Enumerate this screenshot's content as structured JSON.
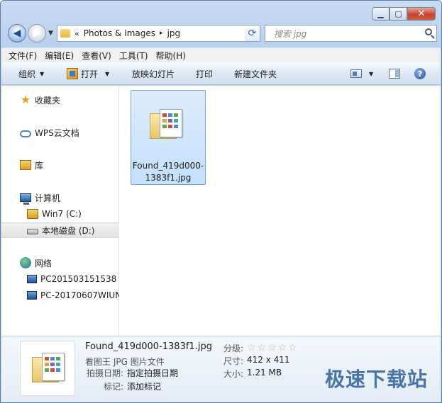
{
  "address": {
    "chevrons": "«",
    "segments": [
      "Photos & Images",
      "jpg"
    ],
    "separator": "▸"
  },
  "search": {
    "placeholder": "搜索 jpg"
  },
  "menu": [
    "文件(F)",
    "编辑(E)",
    "查看(V)",
    "工具(T)",
    "帮助(H)"
  ],
  "toolbar": {
    "organize": "组织",
    "open": "打开",
    "slideshow": "放映幻灯片",
    "print": "打印",
    "new_folder": "新建文件夹"
  },
  "nav": {
    "favorites": "收藏夹",
    "wps_cloud": "WPS云文档",
    "library": "库",
    "computer": "计算机",
    "drive_c": "Win7 (C:)",
    "drive_d": "本地磁盘 (D:)",
    "network": "网络",
    "pc1": "PC201503151538",
    "pc2": "PC-20170607WIUN"
  },
  "file": {
    "name": "Found_419d000-1383f1.jpg"
  },
  "details": {
    "title": "Found_419d000-1383f1.jpg",
    "type": "看图王 JPG 图片文件",
    "rating_label": "分级:",
    "rating_stars": 0,
    "rating_max": 5,
    "size_label": "尺寸:",
    "size_value": "412 x 411",
    "filesize_label": "大小:",
    "filesize_value": "1.21 MB",
    "date_label": "拍摄日期:",
    "date_value": "指定拍摄日期",
    "tags_label": "标记:",
    "tags_value": "添加标记"
  },
  "watermark": "极速下载站",
  "colors": {
    "selection": "#c4e0fc",
    "accent": "#2d5f9c"
  }
}
